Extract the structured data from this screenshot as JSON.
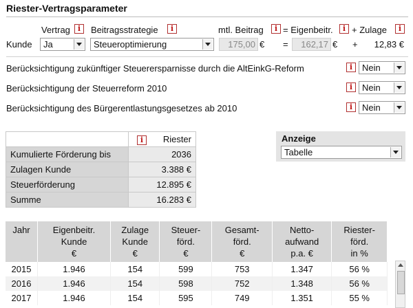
{
  "header": {
    "title": "Riester-Vertragsparameter"
  },
  "params": {
    "vertrag_label": "Vertrag",
    "strategie_label": "Beitragsstrategie",
    "beitrag_label": "mtl. Beitrag",
    "eigen_label": "= Eigenbeitr.",
    "zulage_label": "+ Zulage",
    "kunde_label": "Kunde",
    "vertrag_value": "Ja",
    "strategie_value": "Steueroptimierung",
    "beitrag_value": "175,00",
    "beitrag_unit": "€",
    "eq_sign": "=",
    "eigen_value": "162,17",
    "eigen_unit": "€",
    "plus_sign": "+",
    "zulage_value": "12,83 €"
  },
  "options": [
    {
      "label": "Berücksichtigung zukünftiger Steuerersparnisse durch die AltEinkG-Reform",
      "value": "Nein"
    },
    {
      "label": "Berücksichtigung der Steuerreform 2010",
      "value": "Nein"
    },
    {
      "label": "Berücksichtigung des Bürgerentlastungsgesetzes ab 2010",
      "value": "Nein"
    }
  ],
  "summary": {
    "header": "Riester",
    "rows": [
      {
        "label": "Kumulierte Förderung bis",
        "value": "2036"
      },
      {
        "label": "Zulagen Kunde",
        "value": "3.388 €"
      },
      {
        "label": "Steuerförderung",
        "value": "12.895 €"
      },
      {
        "label": "Summe",
        "value": "16.283 €"
      }
    ]
  },
  "anzeige": {
    "label": "Anzeige",
    "value": "Tabelle"
  },
  "icons": {
    "info": "i"
  },
  "yearly": {
    "headers": [
      [
        "Jahr"
      ],
      [
        "Eigenbeitr.",
        "Kunde",
        "€"
      ],
      [
        "Zulage",
        "Kunde",
        "€"
      ],
      [
        "Steuer-",
        "förd.",
        "€"
      ],
      [
        "Gesamt-",
        "förd.",
        "€"
      ],
      [
        "Netto-",
        "aufwand",
        "p.a. €"
      ],
      [
        "Riester-",
        "förd.",
        "in %"
      ]
    ],
    "rows": [
      [
        "2015",
        "1.946",
        "154",
        "599",
        "753",
        "1.347",
        "56 %"
      ],
      [
        "2016",
        "1.946",
        "154",
        "598",
        "752",
        "1.348",
        "56 %"
      ],
      [
        "2017",
        "1.946",
        "154",
        "595",
        "749",
        "1.351",
        "55 %"
      ]
    ]
  }
}
